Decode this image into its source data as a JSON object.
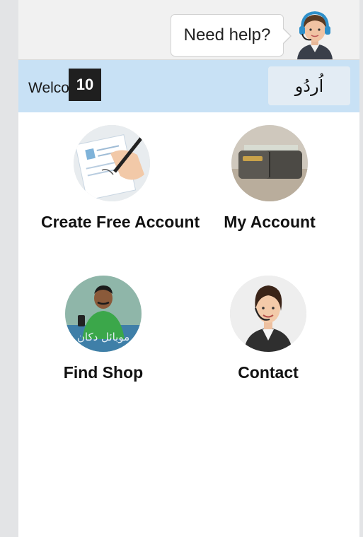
{
  "header": {
    "help_label": "Need help?"
  },
  "welcome_bar": {
    "welcome_text": "Welco",
    "badge": "10",
    "language_button": "اُردُو"
  },
  "tiles": [
    {
      "label": "Create Free Account",
      "icon": "signing-document-icon"
    },
    {
      "label": "My Account",
      "icon": "wallet-icon"
    },
    {
      "label": "Find Shop",
      "icon": "shopkeeper-icon",
      "image_text": "موبائل دکان"
    },
    {
      "label": "Contact",
      "icon": "support-agent-icon"
    }
  ],
  "colors": {
    "welcome_bar": "#c8e1f5",
    "topbar": "#f1f1f1",
    "background": "#e3e4e6"
  }
}
